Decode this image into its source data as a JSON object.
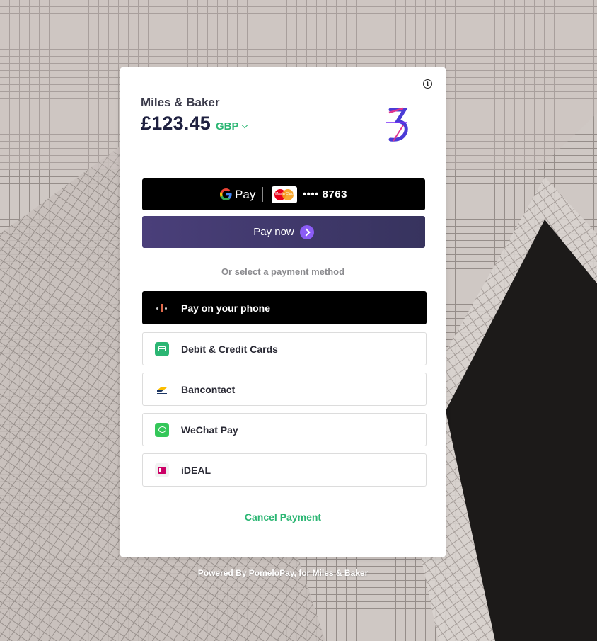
{
  "header": {
    "merchant_name": "Miles & Baker",
    "amount": "£123.45",
    "currency": "GBP",
    "info_icon": "info-icon",
    "logo_icon": "merchant-logo-icon"
  },
  "wallet": {
    "gpay_label": "Pay",
    "card_brand_label": "MasterCard",
    "masked_card": "•••• 8763",
    "pay_now_label": "Pay now"
  },
  "methods": {
    "heading": "Or select a payment method",
    "items": [
      {
        "label": "Pay on your phone",
        "icon": "phone-icon",
        "selected": true
      },
      {
        "label": "Debit & Credit Cards",
        "icon": "card-icon",
        "selected": false
      },
      {
        "label": "Bancontact",
        "icon": "bancontact-icon",
        "selected": false
      },
      {
        "label": "WeChat Pay",
        "icon": "wechat-icon",
        "selected": false
      },
      {
        "label": "iDEAL",
        "icon": "ideal-icon",
        "selected": false
      }
    ]
  },
  "footer": {
    "cancel_label": "Cancel Payment",
    "powered_by": "Powered By PomeloPay, for Miles & Baker"
  },
  "colors": {
    "accent_green": "#2bb673",
    "pay_now_purple": "#3d3768",
    "heading_dark": "#1f2140"
  }
}
